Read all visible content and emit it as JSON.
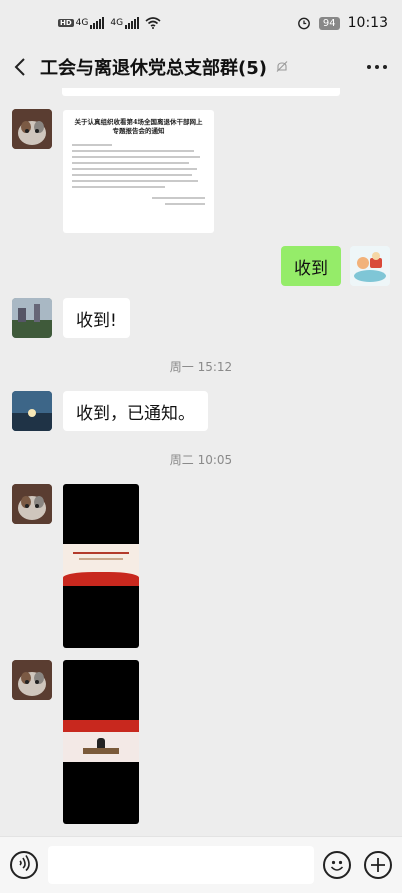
{
  "status_bar": {
    "network_1": "4G",
    "network_2": "4G",
    "battery": "94",
    "time": "10:13"
  },
  "header": {
    "title": "工会与离退休党总支部群(5)"
  },
  "messages": {
    "doc_title": "关于认真组织收看第4场全国离退休干部网上专题报告会的通知",
    "reply_1": "收到",
    "reply_2": "收到!",
    "time_1": "周一 15:12",
    "reply_3": "收到，已通知。",
    "time_2": "周二 10:05"
  },
  "colors": {
    "green_bubble": "#95ec69",
    "background": "#ededed"
  }
}
